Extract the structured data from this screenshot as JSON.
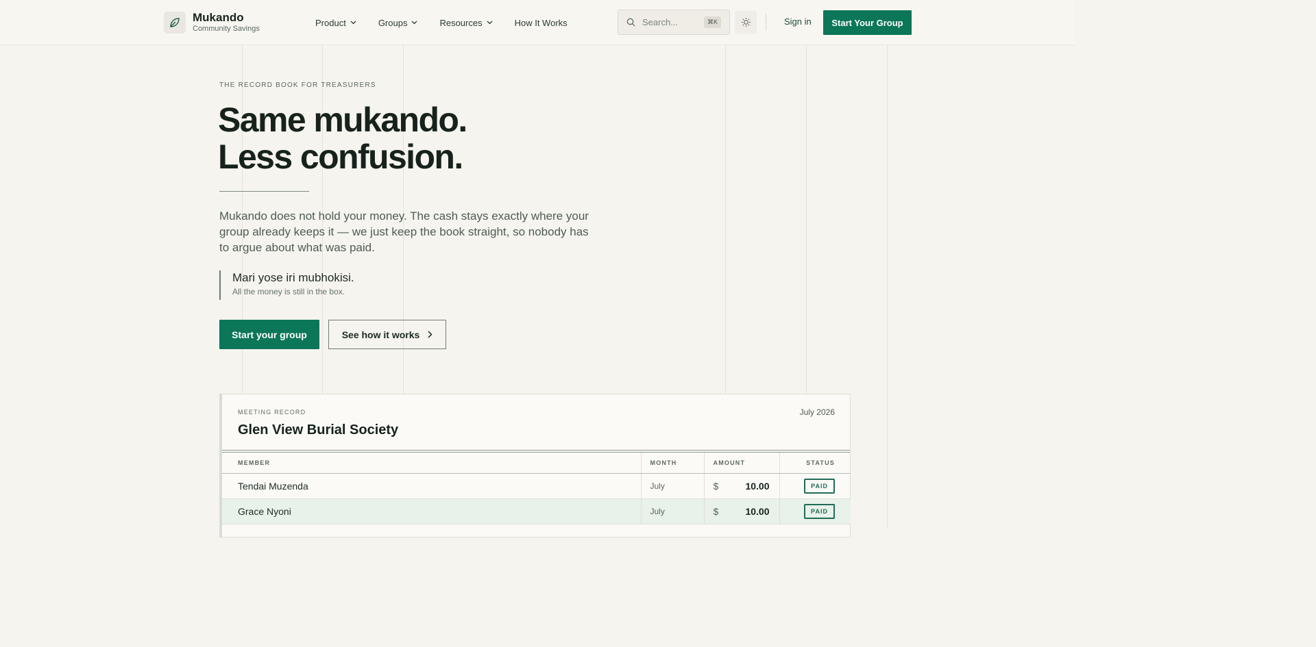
{
  "header": {
    "brand_name": "Mukando",
    "brand_sub": "Community Savings",
    "nav": [
      {
        "label": "Product"
      },
      {
        "label": "Groups"
      },
      {
        "label": "Resources"
      },
      {
        "label": "How It Works"
      }
    ],
    "search_placeholder": "Search...",
    "search_shortcut": "⌘K",
    "sign_in": "Sign in",
    "cta": "Start Your Group"
  },
  "hero": {
    "eyebrow": "THE RECORD BOOK FOR TREASURERS",
    "title_line1": "Same mukando.",
    "title_line2": "Less confusion.",
    "body": "Mukando does not hold your money. The cash stays exactly where your group already keeps it — we just keep the book straight, so nobody has to argue about what was paid.",
    "quote_main": "Mari yose iri mubhokisi.",
    "quote_sub": "All the money is still in the box.",
    "primary_button": "Start your group",
    "secondary_button": "See how it works"
  },
  "record": {
    "eyebrow": "MEETING RECORD",
    "title": "Glen View Burial Society",
    "date": "July 2026",
    "columns": [
      "MEMBER",
      "MONTH",
      "AMOUNT",
      "STATUS"
    ],
    "rows": [
      {
        "member": "Tendai Muzenda",
        "month": "July",
        "currency": "$",
        "amount": "10.00",
        "status": "PAID"
      },
      {
        "member": "Grace Nyoni",
        "month": "July",
        "currency": "$",
        "amount": "10.00",
        "status": "PAID"
      }
    ]
  },
  "colors": {
    "accent": "#0b7658",
    "background": "#f6f4ee",
    "highlight_row": "#e8f1ea"
  }
}
